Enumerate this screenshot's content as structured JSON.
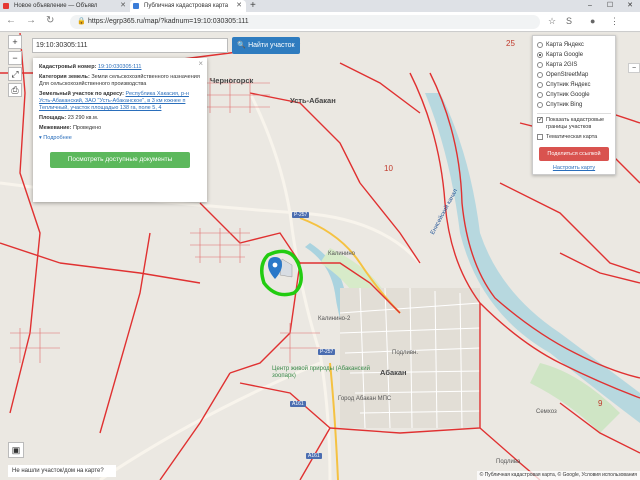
{
  "browser": {
    "tabs": [
      {
        "title": "Новое объявление — Объявл",
        "icon_color": "#e53935"
      },
      {
        "title": "Публичная кадастровая карта",
        "icon_color": "#3b7dd8"
      }
    ],
    "new_tab": "+",
    "url": "https://egrp365.ru/map/?kadnum=19:10:030305:111",
    "window_buttons": [
      "–",
      "☐",
      "✕"
    ]
  },
  "search": {
    "value": "19:10:30305:111",
    "button": "Найти участок"
  },
  "info_panel": {
    "cadnum_label": "Кадастровый номер:",
    "cadnum_value": "19:10:030305:111",
    "category_label": "Категория земель:",
    "category_value": "Земли сельскохозяйственного назначения",
    "usage": "Для сельскохозяйственного производства",
    "address_label": "Земельный участок по адресу:",
    "address_value": "Республика Хакасия, р-н Усть-Абаканский, ЗАО \"Усть-Абаканское\", в 3 км южнее п Тепличный, участок площадью 138 га, поле 5, 4",
    "area_label": "Площадь:",
    "area_value": "23 290 кв.м.",
    "survey_label": "Межевание:",
    "survey_value": "Проведено",
    "more": "Подробнее",
    "docs_button": "Посмотреть доступные документы"
  },
  "layers": {
    "options": [
      {
        "label": "Карта Яндекс",
        "selected": false
      },
      {
        "label": "Карта Google",
        "selected": true
      },
      {
        "label": "Карта 2GIS",
        "selected": false
      },
      {
        "label": "OpenStreetMap",
        "selected": false
      },
      {
        "label": "Спутник Яндекс",
        "selected": false
      },
      {
        "label": "Спутник Google",
        "selected": false
      },
      {
        "label": "Спутник Bing",
        "selected": false
      }
    ],
    "show_boundaries": "Показать кадастровые границы участков",
    "thematic": "Тематическая карта",
    "share_button": "Поделиться ссылкой",
    "setup_link": "Настроить карту"
  },
  "map_labels": {
    "chernogorsk": "Черногорск",
    "ust_abakan": "Усть-Абакан",
    "abakan": "Абакан",
    "kalinino": "Калинино",
    "kalinino2": "Калинино-2",
    "zoo": "Центр живой природы (Абаканский зоопарк)",
    "podlivn": "Подливн.",
    "river": "Енисейский канал",
    "dogcity": "Город Абакан МПС",
    "r257": "Р-257",
    "a161": "А161",
    "num10": "10",
    "num25": "25",
    "num9": "9",
    "semchoz": "Семхоз",
    "podlivn2": "Подлива"
  },
  "bottom_tip": "Не нашли участок/дом на карте?",
  "copyright": "© Публичная кадастровая карта, © Google, Условия использования",
  "colors": {
    "boundary": "#e03131",
    "highlight": "#22cc11",
    "marker": "#2a78c8",
    "find_button": "#2f7cbf",
    "docs_button": "#5cb85c",
    "share_button": "#d9534f"
  }
}
